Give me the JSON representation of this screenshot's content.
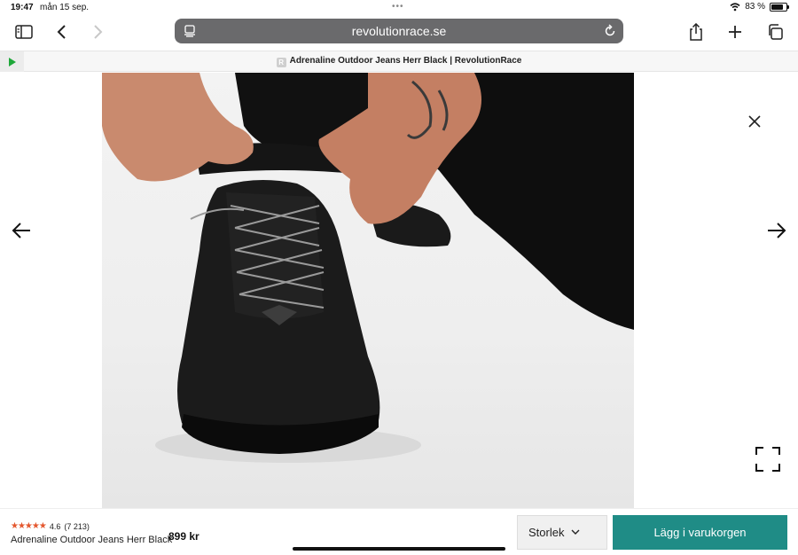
{
  "status_bar": {
    "time": "19:47",
    "date": "mån 15 sep.",
    "battery_percent": "83 %",
    "battery_level": 0.83
  },
  "browser": {
    "url": "revolutionrace.se",
    "tab_title": "Adrenaline Outdoor Jeans Herr Black | RevolutionRace",
    "favicon_letter": "R"
  },
  "icons": {
    "sidebar": "sidebar-icon",
    "back": "chevron-left-icon",
    "forward": "chevron-right-icon",
    "share": "share-icon",
    "new_tab": "plus-icon",
    "tabs": "tabs-icon",
    "reload": "reload-icon",
    "close": "close-icon",
    "prev": "arrow-left-icon",
    "next": "arrow-right-icon",
    "fullscreen": "fullscreen-icon",
    "play": "play-icon",
    "wifi": "wifi-icon"
  },
  "product": {
    "rating_value": "4.6",
    "rating_count": "(7 213)",
    "stars": "★★★★★",
    "name": "Adrenaline Outdoor Jeans Herr Black",
    "price": "899 kr"
  },
  "actions": {
    "size_label": "Storlek",
    "add_to_cart_label": "Lägg i varukorgen"
  },
  "colors": {
    "accent": "#1f8c86",
    "stars": "#e4572e",
    "url_bar": "#6a6a6c",
    "play": "#1fa83a"
  }
}
